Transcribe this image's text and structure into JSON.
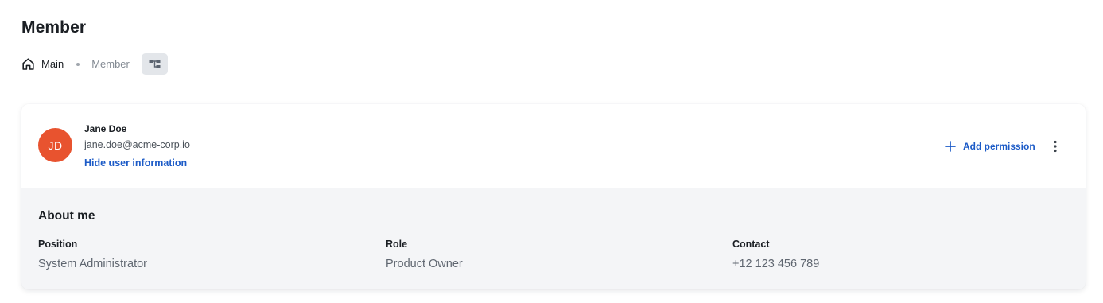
{
  "page": {
    "title": "Member"
  },
  "breadcrumb": {
    "home_icon": "home-icon",
    "home_label": "Main",
    "current_label": "Member",
    "tree_icon": "org-tree-icon"
  },
  "user": {
    "initials": "JD",
    "avatar_color": "#e8532f",
    "name": "Jane Doe",
    "email": "jane.doe@acme-corp.io",
    "hide_info_label": "Hide user information"
  },
  "actions": {
    "add_permission_label": "Add permission",
    "add_icon": "plus-icon",
    "more_icon": "more-vertical-icon"
  },
  "about": {
    "title": "About me",
    "fields": [
      {
        "label": "Position",
        "value": "System Administrator"
      },
      {
        "label": "Role",
        "value": "Product Owner"
      },
      {
        "label": "Contact",
        "value": "+12 123 456 789"
      }
    ]
  },
  "colors": {
    "link": "#1c5bc7",
    "card_bg": "#f4f5f7",
    "text": "#1b1f24"
  }
}
